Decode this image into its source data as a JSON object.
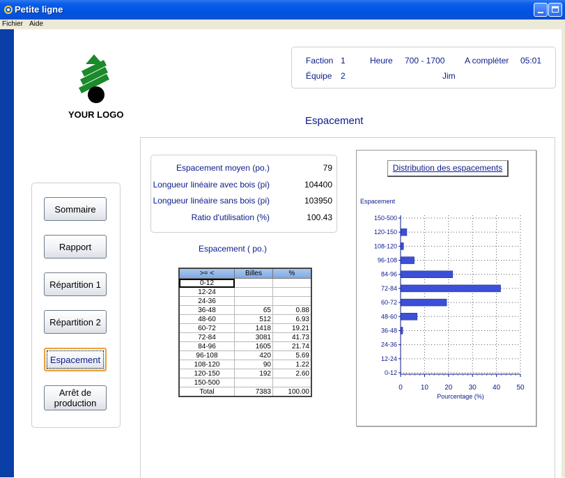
{
  "window": {
    "title": "Petite ligne"
  },
  "menu": [
    "Fichier",
    "Aide"
  ],
  "logo": {
    "text": "YOUR LOGO"
  },
  "info": {
    "faction_label": "Faction",
    "faction_value": "1",
    "heure_label": "Heure",
    "heure_value": "700 - 1700",
    "complete_label": "A compléter",
    "complete_value": "05:01",
    "equipe_label": "Équipe",
    "equipe_value": "2",
    "operator": "Jim"
  },
  "page_title": "Espacement",
  "nav": {
    "sommaire": "Sommaire",
    "rapport": "Rapport",
    "repartition1": "Répartition 1",
    "repartition2": "Répartition 2",
    "espacement": "Espacement",
    "arret_line1": "Arrêt de",
    "arret_line2": "production"
  },
  "stats": [
    {
      "label": "Espacement moyen (po.)",
      "value": "79"
    },
    {
      "label": "Longueur linéaire avec bois (pi)",
      "value": "104400"
    },
    {
      "label": "Longueur linéaire sans bois (pi)",
      "value": "103950"
    },
    {
      "label": "Ratio d'utilisation (%)",
      "value": "100.43"
    }
  ],
  "table": {
    "title": "Espacement ( po.)",
    "headers": [
      ">=   <",
      "Billes",
      "%"
    ],
    "rows": [
      [
        "0-12",
        "",
        ""
      ],
      [
        "12-24",
        "",
        ""
      ],
      [
        "24-36",
        "",
        ""
      ],
      [
        "36-48",
        "65",
        "0.88"
      ],
      [
        "48-60",
        "512",
        "6.93"
      ],
      [
        "60-72",
        "1418",
        "19.21"
      ],
      [
        "72-84",
        "3081",
        "41.73"
      ],
      [
        "84-96",
        "1605",
        "21.74"
      ],
      [
        "96-108",
        "420",
        "5.69"
      ],
      [
        "108-120",
        "90",
        "1.22"
      ],
      [
        "120-150",
        "192",
        "2.60"
      ],
      [
        "150-500",
        "",
        ""
      ]
    ],
    "total": [
      "Total",
      "7383",
      "100.00"
    ]
  },
  "chart_button": "Distribution des espacements",
  "chart_data": {
    "type": "bar",
    "orientation": "horizontal",
    "ylabel": "Espacement",
    "xlabel": "Pourcentage (%)",
    "categories": [
      "0-12",
      "12-24",
      "24-36",
      "36-48",
      "48-60",
      "60-72",
      "72-84",
      "84-96",
      "96-108",
      "108-120",
      "120-150",
      "150-500"
    ],
    "values": [
      0,
      0,
      0,
      0.88,
      6.93,
      19.21,
      41.73,
      21.74,
      5.69,
      1.22,
      2.6,
      0
    ],
    "xlim": [
      0,
      50
    ],
    "xticks": [
      0,
      10,
      20,
      30,
      40,
      50
    ],
    "grid": true,
    "bar_color": "#3b4fd8"
  },
  "colors": {
    "label_text": "#0b1a8a",
    "titlebar": "#0054e3",
    "active_border": "#e8a33a"
  }
}
